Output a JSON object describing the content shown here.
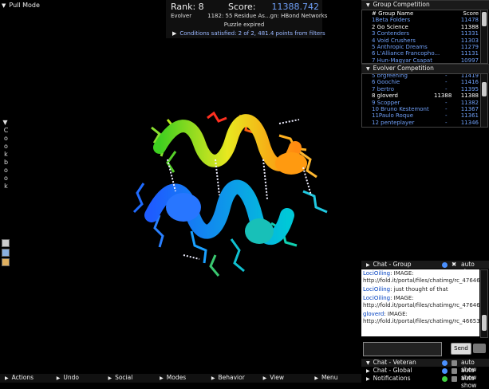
{
  "top": {
    "pull_mode": "Pull Mode"
  },
  "score": {
    "rank_label": "Rank: 8",
    "score_label": "Score:",
    "score_value": "11388.742",
    "evolver_label": "Evolver",
    "evolver_detail": "1182: 55 Residue As...gn: HBond Networks",
    "status": "Puzzle expired",
    "conditions": "Conditions satisfied: 2 of 2, 481.4 points from filters"
  },
  "cookbook": {
    "label": "Cookbook"
  },
  "group_competition": {
    "title": "Group Competition",
    "header_name": "# Group Name",
    "header_score": "Score",
    "rows": [
      {
        "name": "1Beta Folders",
        "score": "11478"
      },
      {
        "name": "2 Go Science",
        "score": "11388"
      },
      {
        "name": "3 Contenders",
        "score": "11331"
      },
      {
        "name": "4 Void Crushers",
        "score": "11303"
      },
      {
        "name": "5 Anthropic Dreams",
        "score": "11279"
      },
      {
        "name": "6 L'Alliance Francopho...",
        "score": "11131"
      },
      {
        "name": "7 Hun-Magyar Csapat",
        "score": "10997"
      }
    ]
  },
  "evolver_competition": {
    "title": "Evolver Competition",
    "rows": [
      {
        "name": "5 brgreening",
        "dash": "-",
        "score": "11419"
      },
      {
        "name": "6 Goochie",
        "dash": "-",
        "score": "11416"
      },
      {
        "name": "7 bertro",
        "dash": "-",
        "score": "11395"
      },
      {
        "name": "8 gloverd",
        "dash": "11388",
        "score": "11388"
      },
      {
        "name": "9 Scopper",
        "dash": "-",
        "score": "11382"
      },
      {
        "name": "10 Bruno Kestemont",
        "dash": "-",
        "score": "11367"
      },
      {
        "name": "11Paulo Roque",
        "dash": "-",
        "score": "11361"
      },
      {
        "name": "12 penteplayer",
        "dash": "-",
        "score": "11346"
      }
    ]
  },
  "chat": {
    "group_title": "Chat - Group",
    "auto_show": "auto show",
    "messages": [
      {
        "who": "LociOiling",
        "text": ": IMAGE: http://fold.it/portal/files/chatimg/rc_476462_1"
      },
      {
        "who": "LociOiling",
        "text": ": just thought of that"
      },
      {
        "who": "LociOiling",
        "text": ": IMAGE: http://fold.it/portal/files/chatimg/rc_476462_1"
      },
      {
        "who": "gloverd",
        "text": ": IMAGE: http://fold.it/portal/files/chatimg/rc_466533_1"
      }
    ],
    "send_label": "Send",
    "veteran_title": "Chat - Veteran",
    "global_title": "Chat - Global",
    "notifications_title": "Notifications"
  },
  "bottom_menu": [
    "Actions",
    "Undo",
    "Social",
    "Modes",
    "Behavior",
    "View",
    "Menu"
  ],
  "colors": {
    "accent_blue": "#6f9ff7",
    "panel_bg": "#1a1a1a"
  }
}
